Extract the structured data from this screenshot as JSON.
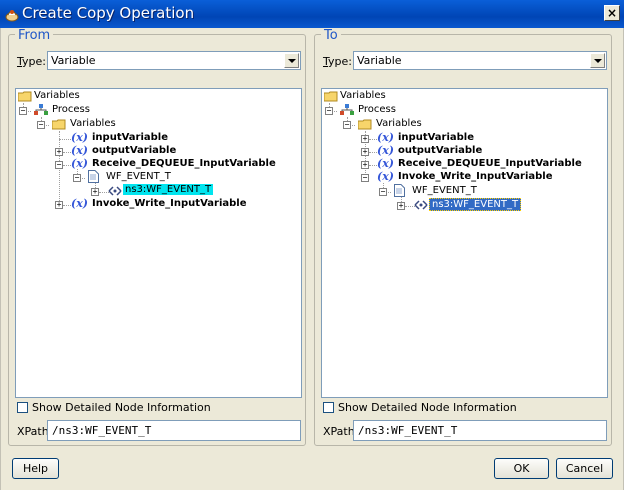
{
  "window": {
    "title": "Create Copy Operation",
    "close_glyph": "×"
  },
  "from": {
    "legend": "From",
    "type_label": "Type:",
    "type_value": "Variable",
    "tree": {
      "root": "Variables",
      "process": "Process",
      "variables": "Variables",
      "items": [
        "inputVariable",
        "outputVariable",
        "Receive_DEQUEUE_InputVariable",
        "Invoke_Write_InputVariable"
      ],
      "wf_event": "WF_EVENT_T",
      "selected": "ns3:WF_EVENT_T",
      "x_glyph": "(x)"
    },
    "show_detail": "Show Detailed Node Information",
    "xpath_label": "XPath:",
    "xpath_value": "/ns3:WF_EVENT_T"
  },
  "to": {
    "legend": "To",
    "type_label": "Type:",
    "type_value": "Variable",
    "tree": {
      "root": "Variables",
      "process": "Process",
      "variables": "Variables",
      "items": [
        "inputVariable",
        "outputVariable",
        "Receive_DEQUEUE_InputVariable",
        "Invoke_Write_InputVariable"
      ],
      "wf_event": "WF_EVENT_T",
      "selected": "ns3:WF_EVENT_T",
      "x_glyph": "(x)"
    },
    "show_detail": "Show Detailed Node Information",
    "xpath_label": "XPath:",
    "xpath_value": "/ns3:WF_EVENT_T"
  },
  "buttons": {
    "help": "Help",
    "ok": "OK",
    "cancel": "Cancel"
  },
  "colors": {
    "selection_from": "#00e5ef",
    "selection_to": "#316ac5",
    "titlebar": "#0045b5",
    "legend": "#1e56c8"
  }
}
